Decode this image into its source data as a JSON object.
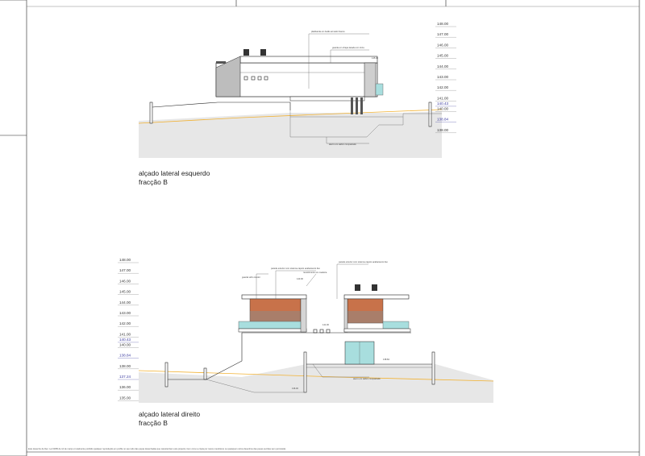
{
  "colors": {
    "terrain_line": "#f2b233",
    "ground_hatch": "#c9c9c9",
    "glazing": "#a8dede",
    "cladding_wood": "#c8724a",
    "wall_grey": "#bdbdbd",
    "level_blue": "#3a3aa0",
    "frame_line": "#222222"
  },
  "views": [
    {
      "caption_line1": "alçado lateral esquerdo",
      "caption_line2": "fracção B",
      "levels": [
        "148.00",
        "147.00",
        "146.00",
        "145.00",
        "144.00",
        "143.00",
        "142.00",
        "141.00",
        "140.43",
        "140.00",
        "138.84",
        "138.00"
      ],
      "highlighted_levels": [
        "140.43",
        "138.84"
      ],
      "notes": {
        "roof_finish": "guarda em chapa lacada cor cinza",
        "roof_note": "platibanda em betão armado branco",
        "lower_note": "aterro em saibro compactado",
        "elev_mark": "145.00"
      }
    },
    {
      "caption_line1": "alçado lateral direito",
      "caption_line2": "fracção B",
      "levels": [
        "148.00",
        "147.00",
        "146.00",
        "145.00",
        "144.00",
        "143.00",
        "142.00",
        "141.00",
        "140.43",
        "140.00",
        "138.84",
        "138.00",
        "137.24",
        "136.00",
        "135.00"
      ],
      "highlighted_levels": [
        "140.43",
        "138.84",
        "137.24"
      ],
      "notes": {
        "left_block": "guarda vidro incolor",
        "center_note_a": "parede exterior com sistema capoto acabamento liso",
        "center_note_b": "revestimento em madeira",
        "right_note": "parede exterior com sistema capoto acabamento liso",
        "lower_note": "aterro em saibro compactado",
        "mark_a": "143.00",
        "mark_b": "141.00",
        "mark_c": "138.84",
        "mark_d": "136.00"
      }
    }
  ],
  "footer_note": "Este desenho de Dec. Lei 63/85 de 14 de março é totalmente proibido qualquer reprodução em profile no seu todo das peças desenhadas que caracterizam este projecto, bem como a cópia por meios mecânicos ou quaisquer outros desenhos das peças escritas sem permissão."
}
